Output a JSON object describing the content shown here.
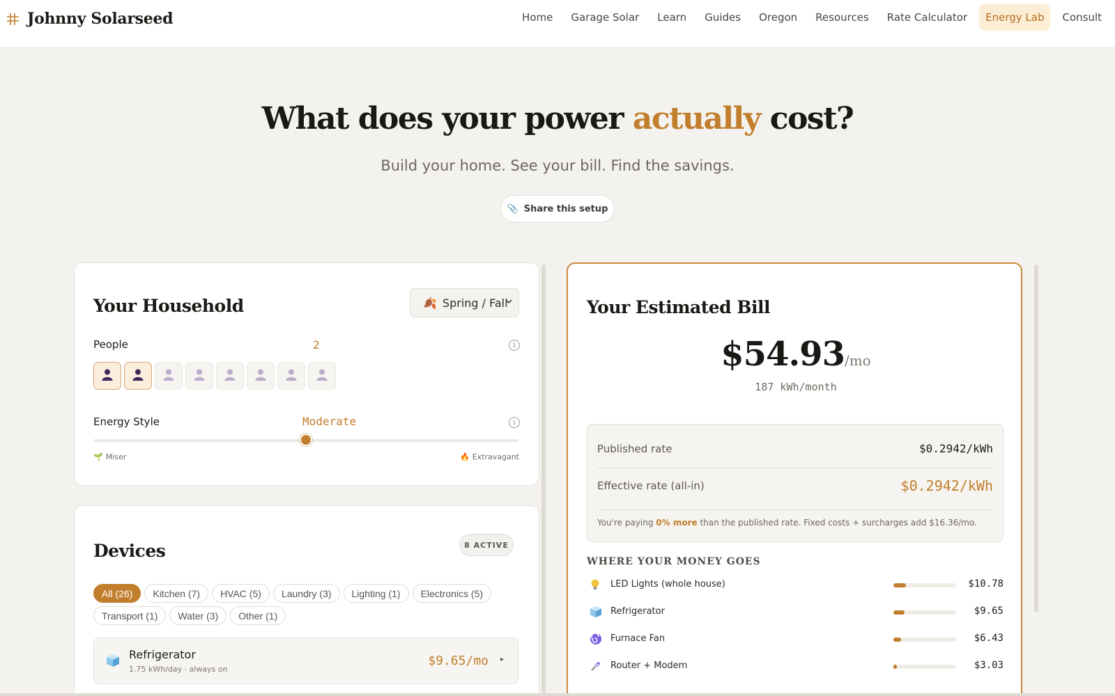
{
  "nav": {
    "brand": "Johnny Solarseed",
    "links": [
      "Home",
      "Garage Solar",
      "Learn",
      "Guides",
      "Oregon",
      "Resources",
      "Rate Calculator",
      "Energy Lab",
      "Consult"
    ],
    "active": "Energy Lab"
  },
  "hero": {
    "title_before": "What does your power ",
    "title_accent": "actually",
    "title_after": " cost?",
    "subtitle": "Build your home. See your bill. Find the savings.",
    "share_label": "Share this setup"
  },
  "household": {
    "title": "Your Household",
    "season": "Spring / Fall",
    "people_label": "People",
    "people_value": "2",
    "people_count": 2,
    "people_max": 8,
    "energy_label": "Energy Style",
    "energy_value": "Moderate",
    "energy_level": 0.5,
    "min_label": "Miser",
    "max_label": "Extravagant"
  },
  "devices": {
    "title": "Devices",
    "active_badge": "8 ACTIVE",
    "chips": [
      "All (26)",
      "Kitchen (7)",
      "HVAC (5)",
      "Laundry (3)",
      "Lighting (1)",
      "Electronics (5)",
      "Transport (1)",
      "Water (3)",
      "Other (1)"
    ],
    "first": {
      "name": "Refrigerator",
      "meta": "1.75 kWh/day · always on",
      "cost": "$9.65/mo"
    }
  },
  "bill": {
    "title": "Your Estimated Bill",
    "amount": "$54.93",
    "per": "/mo",
    "kwh": "187 kWh/month",
    "published_label": "Published rate",
    "published_value": "$0.2942/kWh",
    "effective_label": "Effective rate (all-in)",
    "effective_value": "$0.2942/kWh",
    "note_before": "You're paying ",
    "note_pct": "0% more",
    "note_after": " than the published rate. Fixed costs + surcharges add $16.36/mo.",
    "money_heading": "WHERE YOUR MONEY GOES",
    "breakdown": [
      {
        "name": "LED Lights (whole house)",
        "cost": "$10.78",
        "share": 0.196,
        "icon": "lightbulb-icon"
      },
      {
        "name": "Refrigerator",
        "cost": "$9.65",
        "share": 0.176,
        "icon": "ice-cube-icon"
      },
      {
        "name": "Furnace Fan",
        "cost": "$6.43",
        "share": 0.117,
        "icon": "spiral-icon"
      },
      {
        "name": "Router + Modem",
        "cost": "$3.03",
        "share": 0.055,
        "icon": "satellite-icon"
      }
    ]
  },
  "colors": {
    "accent": "#c17e2c",
    "active_nav_bg": "#fbeed4",
    "page_bg": "#f4f2ee",
    "person_on": "#3d2a5c",
    "person_off": "#b9aecb"
  }
}
